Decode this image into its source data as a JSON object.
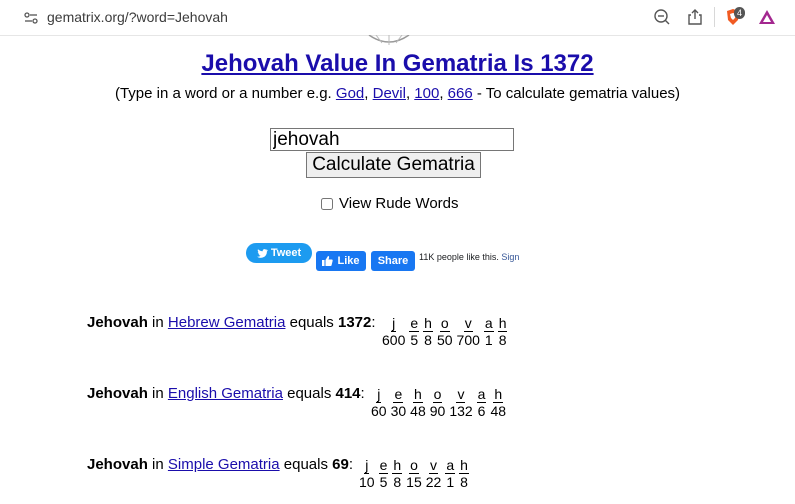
{
  "browser": {
    "url": "gematrix.org/?word=Jehovah",
    "extension_badge": "4"
  },
  "header": {
    "title": "Jehovah Value In Gematria Is 1372",
    "subtitle_prefix": "(Type in a word or a number e.g.",
    "examples": [
      "God",
      "Devil",
      "100",
      "666"
    ],
    "subtitle_suffix": "- To calculate gematria values)"
  },
  "form": {
    "input_value": "jehovah",
    "calculate_label": "Calculate Gematria",
    "rude_label": "View Rude Words"
  },
  "social": {
    "tweet_label": "Tweet",
    "like_label": "Like",
    "share_label": "Share",
    "like_text": "11K people like this.",
    "sign_label": "Sign"
  },
  "results": [
    {
      "word": "Jehovah",
      "in": "in",
      "cipher": "Hebrew Gematria",
      "equals": "equals",
      "value": "1372",
      "letters": [
        "j",
        "e",
        "h",
        "o",
        "v",
        "a",
        "h"
      ],
      "numbers": [
        "600",
        "5",
        "8",
        "50",
        "700",
        "1",
        "8"
      ]
    },
    {
      "word": "Jehovah",
      "in": "in",
      "cipher": "English Gematria",
      "equals": "equals",
      "value": "414",
      "letters": [
        "j",
        "e",
        "h",
        "o",
        "v",
        "a",
        "h"
      ],
      "numbers": [
        "60",
        "30",
        "48",
        "90",
        "132",
        "6",
        "48"
      ]
    },
    {
      "word": "Jehovah",
      "in": "in",
      "cipher": "Simple Gematria",
      "equals": "equals",
      "value": "69",
      "letters": [
        "j",
        "e",
        "h",
        "o",
        "v",
        "a",
        "h"
      ],
      "numbers": [
        "10",
        "5",
        "8",
        "15",
        "22",
        "1",
        "8"
      ]
    }
  ]
}
